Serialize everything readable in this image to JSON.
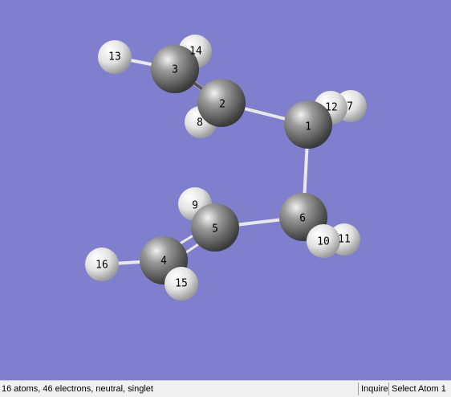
{
  "molecule_view": {
    "background_color": "#7f7fcd",
    "carbon_color": "#6e6e6e",
    "hydrogen_color": "#e6e6e6",
    "bond_color": "#e8e8e8",
    "atoms": [
      {
        "label": "13",
        "element": "H"
      },
      {
        "label": "14",
        "element": "H"
      },
      {
        "label": "3",
        "element": "C"
      },
      {
        "label": "8",
        "element": "H"
      },
      {
        "label": "2",
        "element": "C"
      },
      {
        "label": "7",
        "element": "H"
      },
      {
        "label": "12",
        "element": "H"
      },
      {
        "label": "1",
        "element": "C"
      },
      {
        "label": "9",
        "element": "H"
      },
      {
        "label": "5",
        "element": "C"
      },
      {
        "label": "6",
        "element": "C"
      },
      {
        "label": "11",
        "element": "H"
      },
      {
        "label": "10",
        "element": "H"
      },
      {
        "label": "16",
        "element": "H"
      },
      {
        "label": "4",
        "element": "C"
      },
      {
        "label": "15",
        "element": "H"
      }
    ]
  },
  "statusbar": {
    "summary": "16 atoms, 46 electrons, neutral, singlet",
    "mode": "Inquire",
    "action": "Select Atom 1"
  }
}
